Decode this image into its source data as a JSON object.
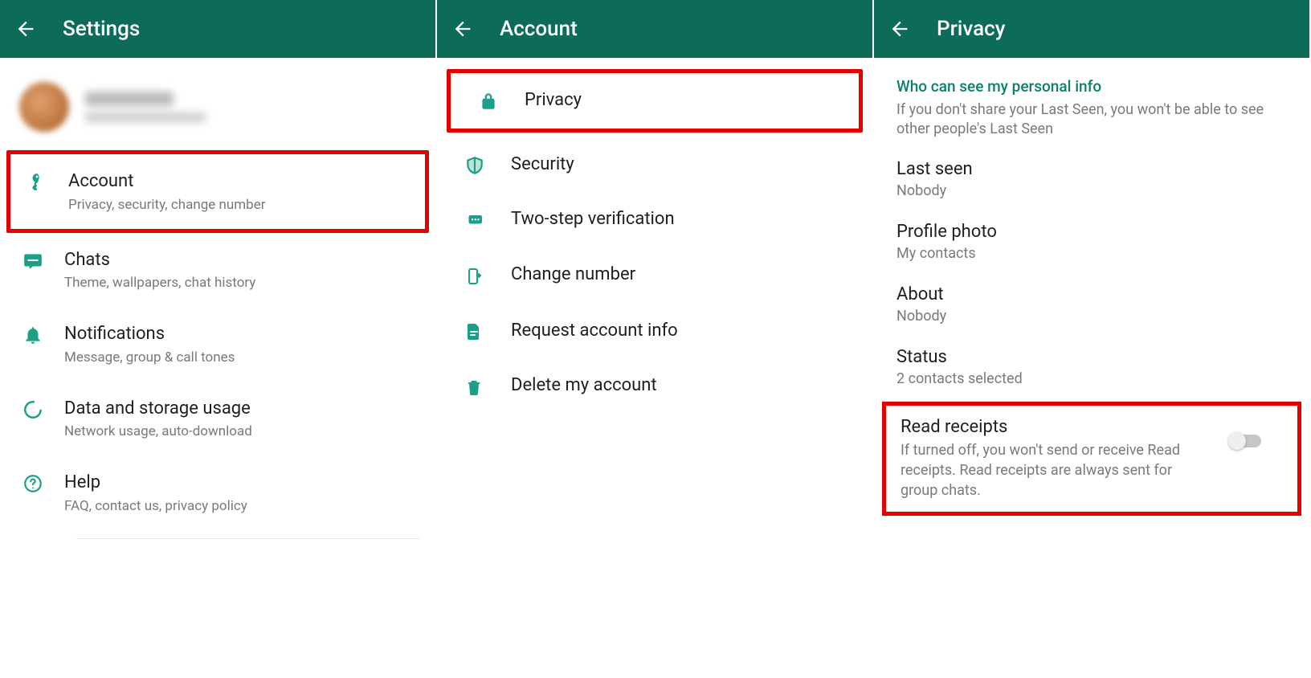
{
  "panel1": {
    "title": "Settings",
    "items": [
      {
        "title": "Account",
        "sub": "Privacy, security, change number"
      },
      {
        "title": "Chats",
        "sub": "Theme, wallpapers, chat history"
      },
      {
        "title": "Notifications",
        "sub": "Message, group & call tones"
      },
      {
        "title": "Data and storage usage",
        "sub": "Network usage, auto-download"
      },
      {
        "title": "Help",
        "sub": "FAQ, contact us, privacy policy"
      }
    ]
  },
  "panel2": {
    "title": "Account",
    "items": [
      {
        "title": "Privacy"
      },
      {
        "title": "Security"
      },
      {
        "title": "Two-step verification"
      },
      {
        "title": "Change number"
      },
      {
        "title": "Request account info"
      },
      {
        "title": "Delete my account"
      }
    ]
  },
  "panel3": {
    "title": "Privacy",
    "sectionHead": "Who can see my personal info",
    "sectionDesc": "If you don't share your Last Seen, you won't be able to see other people's Last Seen",
    "items": [
      {
        "title": "Last seen",
        "value": "Nobody"
      },
      {
        "title": "Profile photo",
        "value": "My contacts"
      },
      {
        "title": "About",
        "value": "Nobody"
      },
      {
        "title": "Status",
        "value": "2 contacts selected"
      }
    ],
    "readReceipts": {
      "title": "Read receipts",
      "desc": "If turned off, you won't send or receive Read receipts. Read receipts are always sent for group chats."
    }
  }
}
